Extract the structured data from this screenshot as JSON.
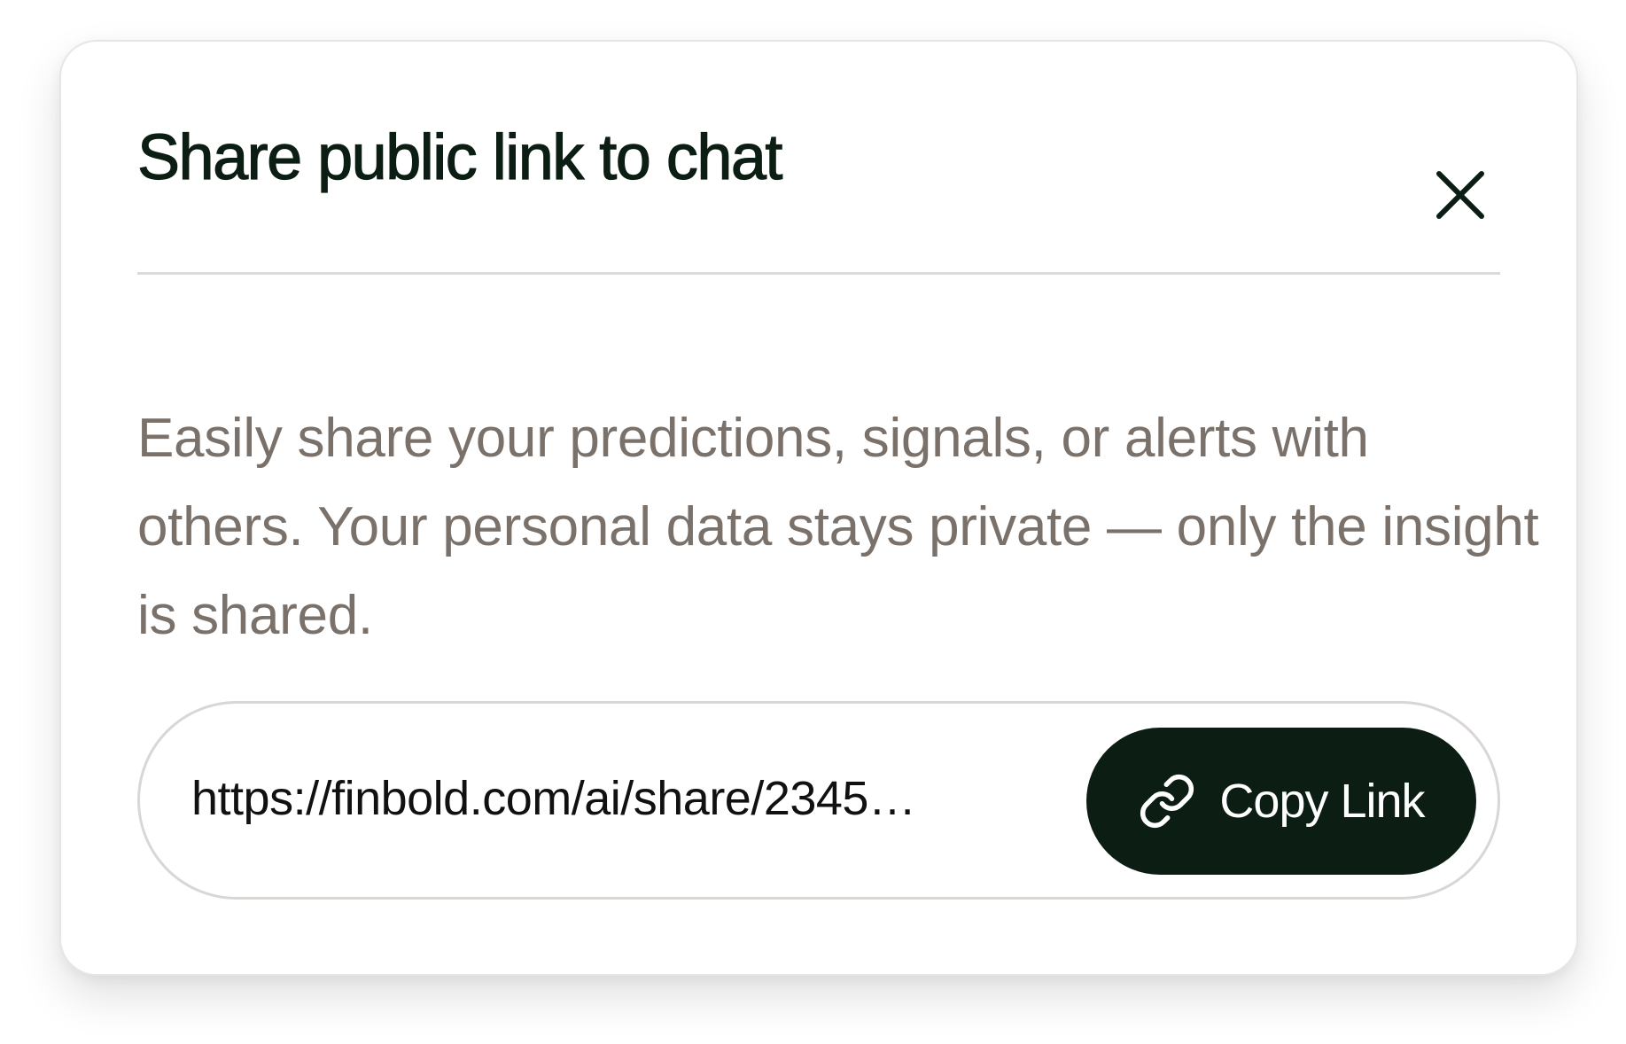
{
  "dialog": {
    "title": "Share public link to chat",
    "close_icon": "close-icon",
    "description": "Easily share your predictions, signals, or alerts with others. Your personal data stays private — only the insight is shared.",
    "link_url": "https://finbold.com/ai/share/2345…",
    "copy_button_label": "Copy Link",
    "copy_icon": "link-icon"
  },
  "colors": {
    "accent": "#0c1e13",
    "text_muted": "#7a716b",
    "border": "#d9d6d4"
  }
}
